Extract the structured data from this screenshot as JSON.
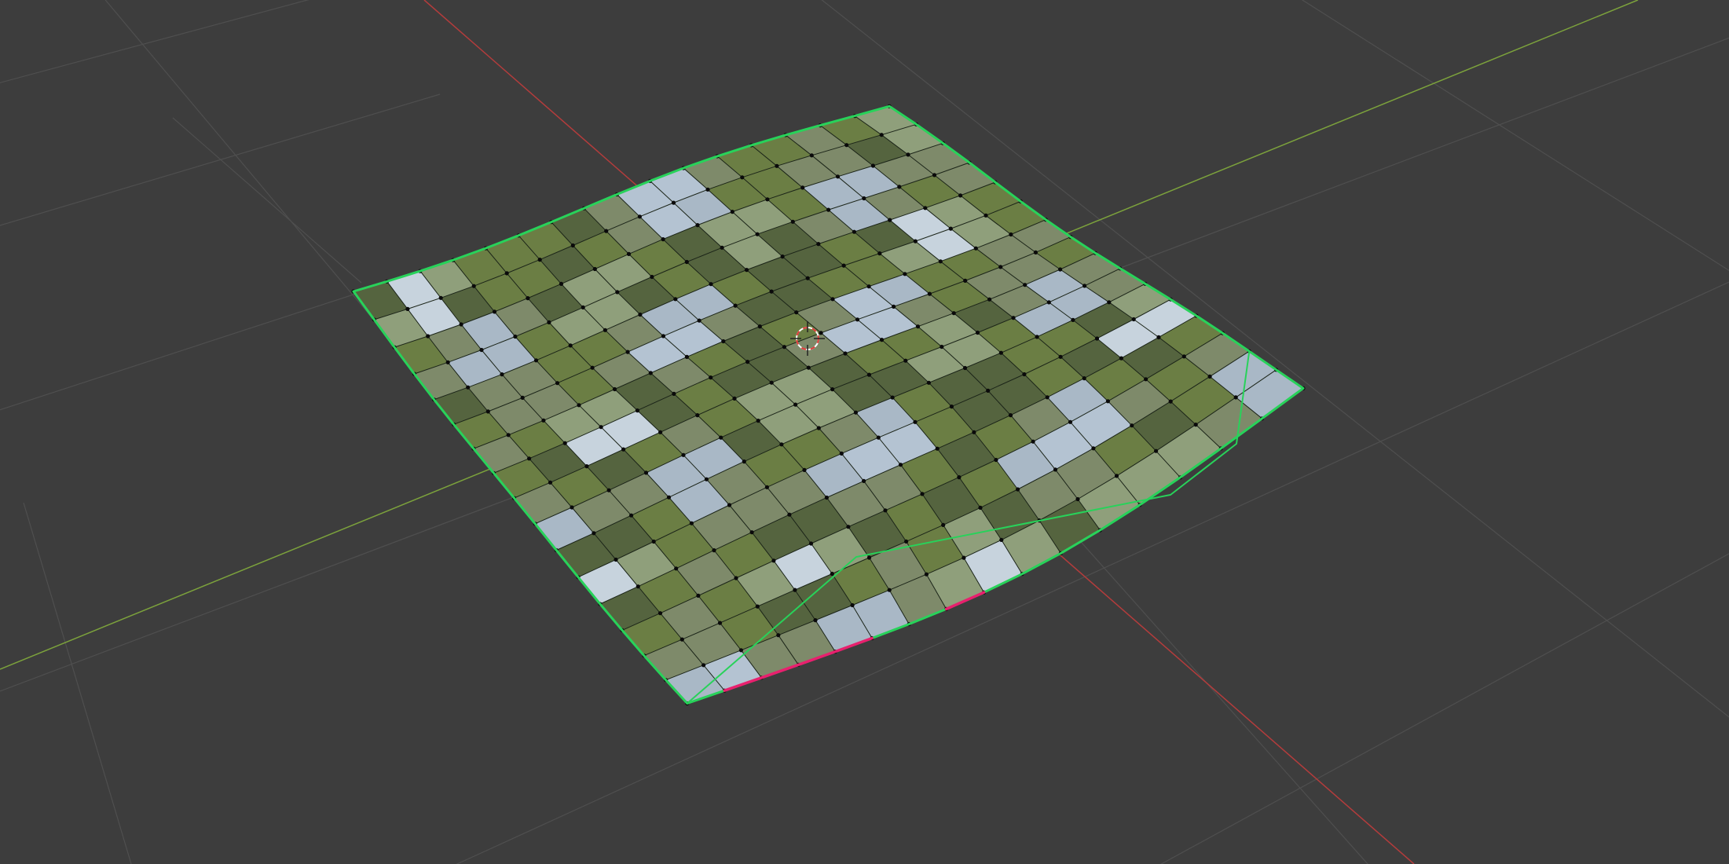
{
  "viewport": {
    "background": "#3d3d3d",
    "grid_color": "#4f4f4f",
    "x_axis_color": "#b43c3c",
    "y_axis_color": "#7ca23c",
    "mesh_select_color": "#28d25a",
    "seam_color": "#e8206e",
    "cursor_colors": [
      "#e23a3a",
      "#ffffff"
    ]
  },
  "mesh": {
    "type": "cloth-grid",
    "subdivisions": 16,
    "texture_palette": [
      "#b4c3d2",
      "#a9b8c6",
      "#7e8a6a",
      "#6b7e44",
      "#55643f",
      "#8f9f7b",
      "#c7d3dd"
    ]
  }
}
